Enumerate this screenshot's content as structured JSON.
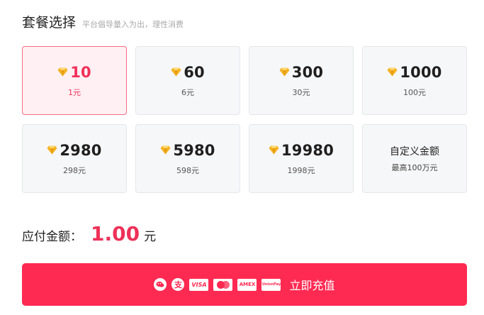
{
  "header": {
    "title": "套餐选择",
    "subtitle": "平台倡导量入为出，理性消费"
  },
  "packages": [
    {
      "amount": "10",
      "price": "1元",
      "selected": true
    },
    {
      "amount": "60",
      "price": "6元"
    },
    {
      "amount": "300",
      "price": "30元"
    },
    {
      "amount": "1000",
      "price": "100元"
    },
    {
      "amount": "2980",
      "price": "298元"
    },
    {
      "amount": "5980",
      "price": "598元"
    },
    {
      "amount": "19980",
      "price": "1998元"
    }
  ],
  "custom": {
    "title": "自定义金额",
    "subtitle": "最高100万元"
  },
  "payment": {
    "label": "应付金额：",
    "amount": "1.00",
    "unit": "元"
  },
  "pay_button": {
    "label": "立即充值",
    "methods": [
      {
        "name": "wechat-pay-icon",
        "text": ""
      },
      {
        "name": "alipay-icon",
        "text": "支"
      },
      {
        "name": "visa-icon",
        "text": "VISA"
      },
      {
        "name": "mastercard-icon",
        "text": ""
      },
      {
        "name": "amex-icon",
        "text": "AMEX"
      },
      {
        "name": "unionpay-icon",
        "text": "UnionPay"
      }
    ]
  },
  "colors": {
    "accent": "#ff2a52",
    "selected_bg": "#fff0f3",
    "coin": "#f5b324"
  }
}
